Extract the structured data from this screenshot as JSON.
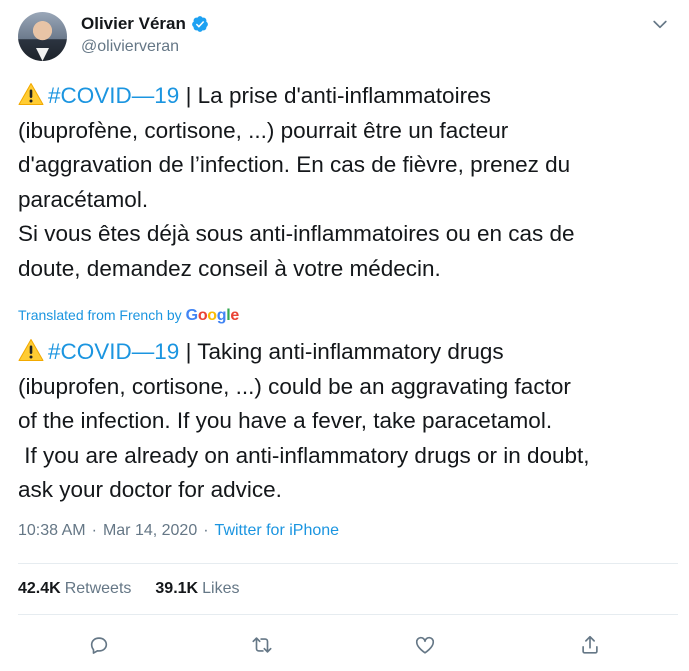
{
  "author": {
    "display_name": "Olivier Véran",
    "handle": "@olivierveran",
    "verified": true
  },
  "icons": {
    "avatar": "avatar",
    "verified": "verified-badge-icon",
    "menu": "chevron-down-icon",
    "warning": "warning-icon",
    "reply": "reply-icon",
    "retweet": "retweet-icon",
    "like": "heart-icon",
    "share": "share-icon"
  },
  "original_text": {
    "hashtag": "#COVID—19",
    "lines": [
      " | La prise d'anti-inflammatoires",
      "(ibuprofène, cortisone, ...) pourrait être un facteur",
      "d'aggravation de l’infection. En cas de fièvre, prenez du",
      "paracétamol.",
      "Si vous êtes déjà sous anti-inflammatoires ou en cas de",
      "doute, demandez conseil à votre médecin."
    ]
  },
  "translation": {
    "label": "Translated from French by",
    "provider": "Google",
    "hashtag": "#COVID—19",
    "lines": [
      " | Taking anti-inflammatory drugs",
      "(ibuprofen, cortisone, ...) could be an aggravating factor",
      "of the infection. If you have a fever, take paracetamol.",
      " If you are already on anti-inflammatory drugs or in doubt,",
      "ask your doctor for advice."
    ]
  },
  "meta": {
    "time": "10:38 AM",
    "separator": "·",
    "date": "Mar 14, 2020",
    "source": "Twitter for iPhone"
  },
  "stats": {
    "retweets_count": "42.4K",
    "retweets_label": "Retweets",
    "likes_count": "39.1K",
    "likes_label": "Likes"
  },
  "colors": {
    "link": "#1b95e0",
    "secondary_text": "#657786",
    "primary_text": "#14171a",
    "divider": "#e6ecf0"
  }
}
